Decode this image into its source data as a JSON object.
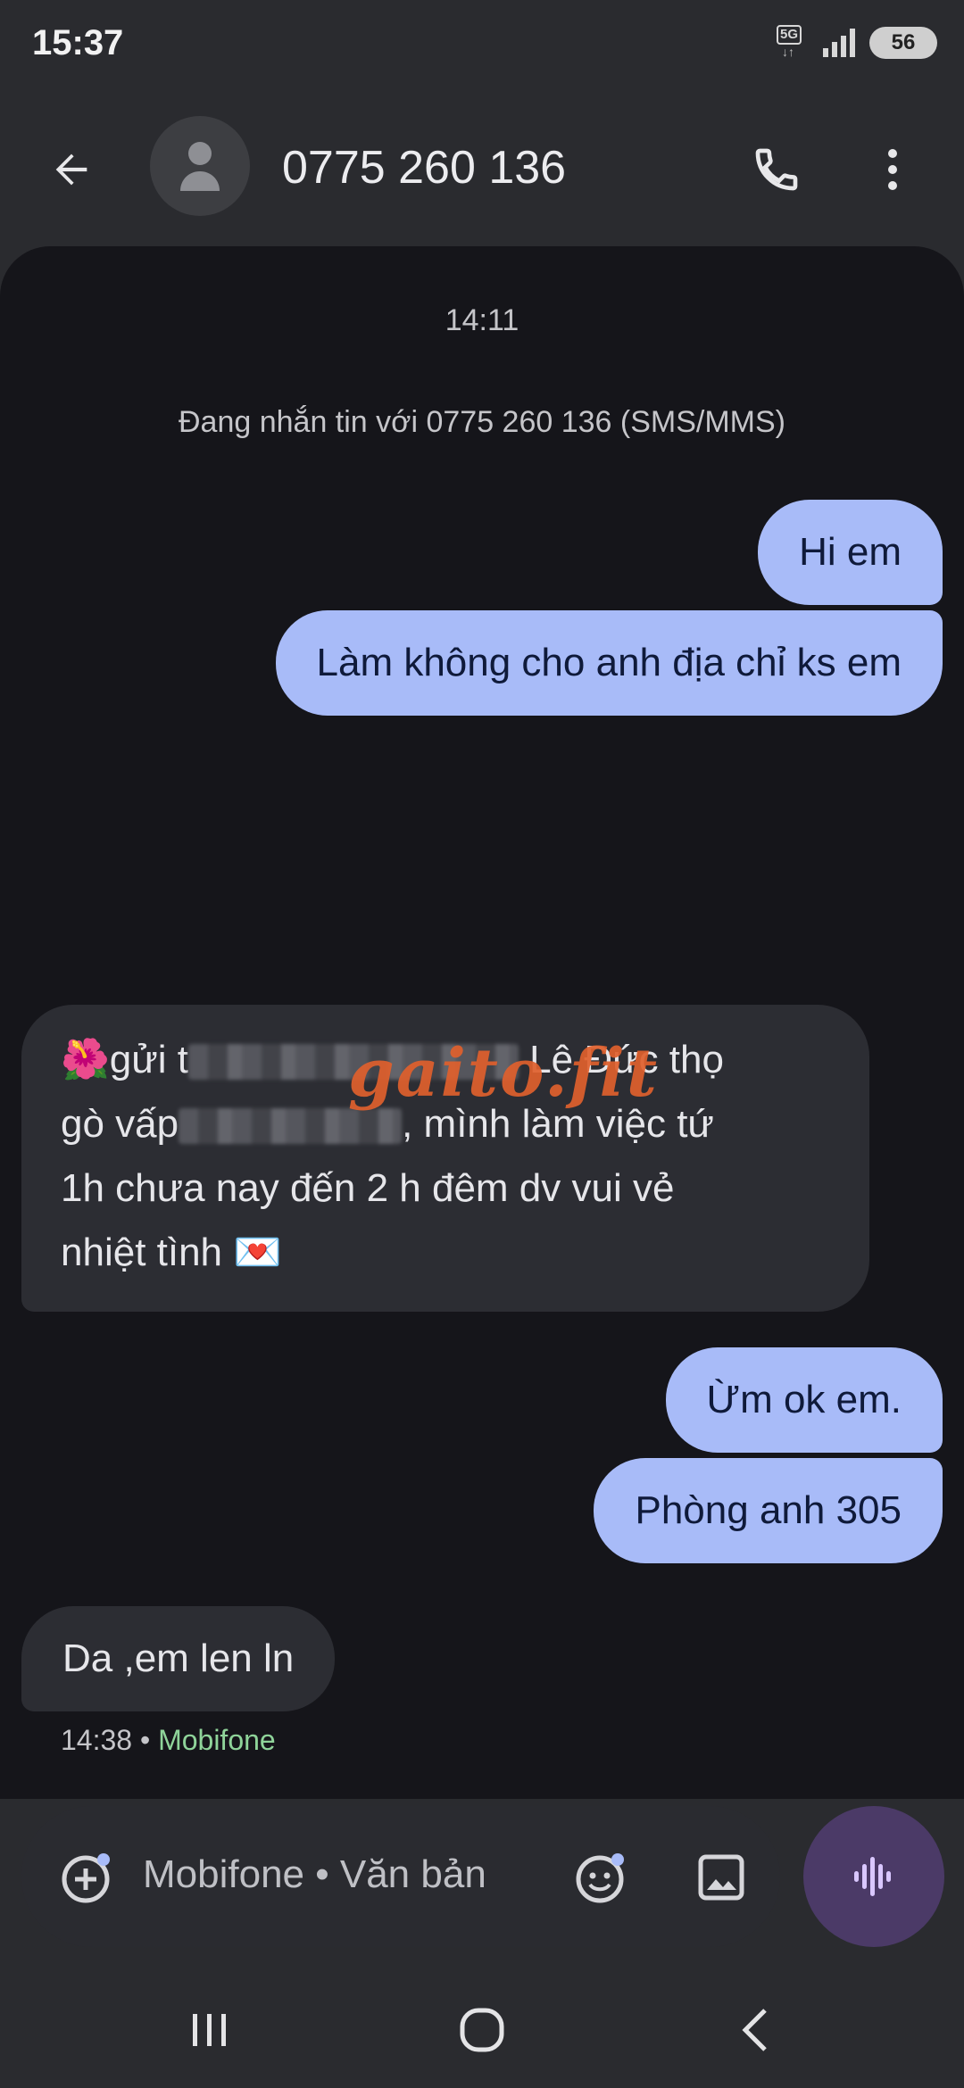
{
  "status_bar": {
    "time": "15:37",
    "network": "5G",
    "battery": "56"
  },
  "header": {
    "title": "0775 260 136"
  },
  "conversation": {
    "timestamp": "14:11",
    "info": "Đang nhắn tin với 0775 260 136 (SMS/MMS)",
    "messages": [
      {
        "direction": "outgoing",
        "text": "Hi em"
      },
      {
        "direction": "outgoing",
        "text": "Làm không cho anh địa chỉ ks em"
      },
      {
        "direction": "incoming",
        "lines": [
          {
            "emoji": "🌺",
            "pre": "gửi t",
            "post": " Lê Đức thọ"
          },
          {
            "pre": "gò vấp",
            "post": ", mình làm việc tứ"
          },
          {
            "text": "1h  chưa nay đến 2 h đêm  dv vui vẻ"
          },
          {
            "text": "nhiệt tình",
            "emoji": "💌"
          }
        ]
      },
      {
        "direction": "outgoing",
        "text": "Ừm ok em."
      },
      {
        "direction": "outgoing",
        "text": "Phòng anh 305"
      },
      {
        "direction": "incoming",
        "text": "Da ,em len ln"
      }
    ],
    "last_message_meta": {
      "time": "14:38",
      "separator": "•",
      "carrier": "Mobifone"
    },
    "watermark": "gaito.fit"
  },
  "composer": {
    "placeholder": "Mobifone • Văn bản"
  },
  "icons": {
    "back": "arrow-left-icon",
    "avatar": "person-icon",
    "call": "phone-icon",
    "more": "more-vertical-icon",
    "add": "add-circle-icon",
    "emoji": "emoji-icon",
    "image": "image-icon",
    "voice": "voice-waveform-icon"
  },
  "colors": {
    "background": "#2a2b2f",
    "conversation_bg": "#15151a",
    "outgoing_bubble": "#a8bbf8",
    "incoming_bubble": "#2c2d33",
    "voice_button": "#4b3a67",
    "carrier_text": "#8fd49a"
  }
}
